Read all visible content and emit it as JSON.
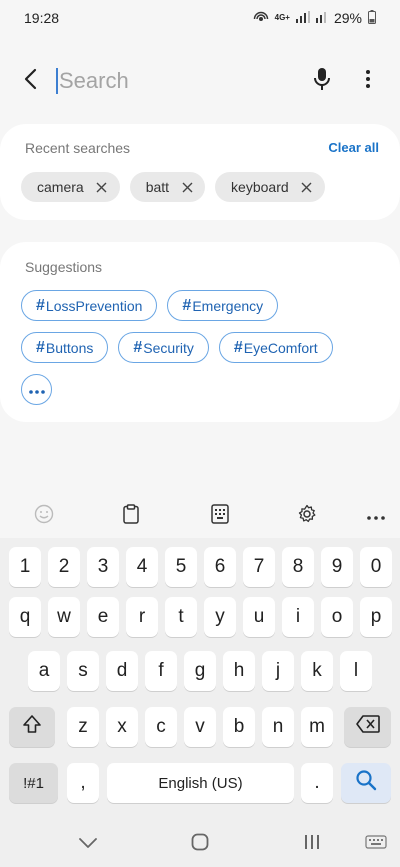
{
  "status_bar": {
    "time": "19:28",
    "network": "4G+",
    "battery_percent": "29%"
  },
  "search": {
    "placeholder": "Search",
    "value": ""
  },
  "recent": {
    "title": "Recent searches",
    "clear_all_label": "Clear all",
    "items": [
      {
        "label": "camera"
      },
      {
        "label": "batt"
      },
      {
        "label": "keyboard"
      }
    ]
  },
  "suggestions": {
    "title": "Suggestions",
    "hash_symbol": "#",
    "rows": [
      [
        {
          "label": "LossPrevention"
        },
        {
          "label": "Emergency"
        }
      ],
      [
        {
          "label": "Buttons"
        },
        {
          "label": "Security"
        },
        {
          "label": "EyeComfort"
        }
      ]
    ]
  },
  "keyboard": {
    "number_row": [
      "1",
      "2",
      "3",
      "4",
      "5",
      "6",
      "7",
      "8",
      "9",
      "0"
    ],
    "row1": [
      "q",
      "w",
      "e",
      "r",
      "t",
      "y",
      "u",
      "i",
      "o",
      "p"
    ],
    "row2": [
      "a",
      "s",
      "d",
      "f",
      "g",
      "h",
      "j",
      "k",
      "l"
    ],
    "row3": [
      "z",
      "x",
      "c",
      "v",
      "b",
      "n",
      "m"
    ],
    "symbols_label": "!#1",
    "comma_label": ",",
    "space_label": "English (US)",
    "period_label": "."
  },
  "colors": {
    "accent": "#1a73c8",
    "tag_border": "#6aa6e4",
    "card_bg": "#ffffff",
    "page_bg": "#f6f6f6",
    "keyboard_bg": "#efefef"
  },
  "icons": {
    "back": "back-arrow-icon",
    "mic": "mic-icon",
    "more": "more-vertical-icon",
    "chip_remove": "close-icon",
    "more_tags": "more-horizontal-icon",
    "emoji": "emoji-icon",
    "clipboard": "clipboard-icon",
    "keyboard_mode": "keyboard-mode-icon",
    "settings": "gear-icon",
    "shift": "shift-icon",
    "backspace": "backspace-icon",
    "search_key": "search-icon"
  }
}
